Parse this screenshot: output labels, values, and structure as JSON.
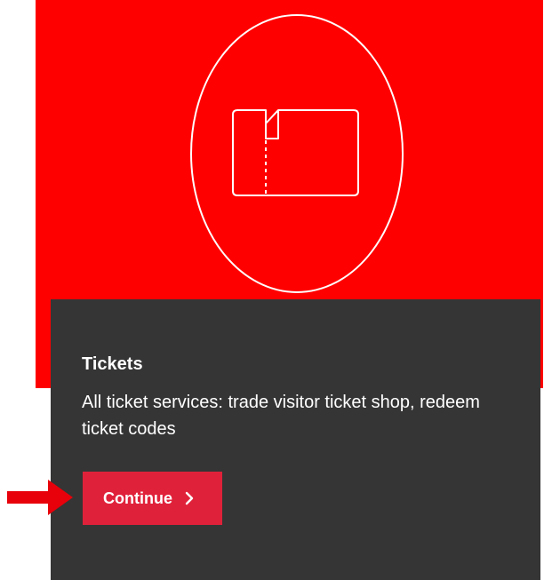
{
  "colors": {
    "hero_background": "#ff0000",
    "card_background": "#353535",
    "button_background": "#e0213a",
    "text": "#ffffff",
    "pointer_arrow": "#e8000a"
  },
  "hero": {
    "icon": "ticket-icon"
  },
  "card": {
    "title": "Tickets",
    "description": "All ticket services: trade visitor ticket shop, redeem ticket codes",
    "button_label": "Continue",
    "button_icon": "chevron-right-icon"
  },
  "annotation": {
    "icon": "red-arrow-icon"
  }
}
